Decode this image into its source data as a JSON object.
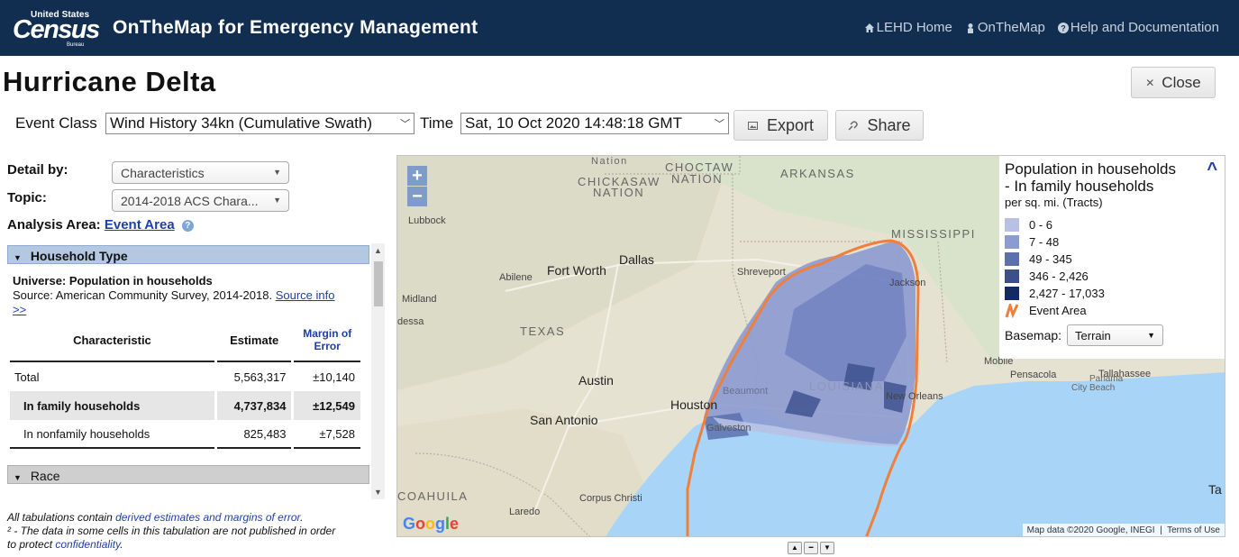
{
  "header": {
    "logo_line1": "United States",
    "logo_line2": "Census",
    "logo_line3": "Bureau",
    "app_title": "OnTheMap for Emergency Management",
    "nav": [
      {
        "label": "LEHD Home",
        "icon": "home-icon"
      },
      {
        "label": "OnTheMap",
        "icon": "person-icon"
      },
      {
        "label": "Help and Documentation",
        "icon": "help-circle-icon"
      }
    ]
  },
  "page": {
    "title": "Hurricane Delta",
    "close_label": "Close"
  },
  "controls": {
    "event_class_label": "Event Class",
    "event_class_value": "Wind History 34kn (Cumulative Swath)",
    "time_label": "Time",
    "time_value": "Sat, 10 Oct 2020 14:48:18 GMT",
    "export_label": "Export",
    "share_label": "Share"
  },
  "panel": {
    "detail_label": "Detail by:",
    "detail_value": "Characteristics",
    "topic_label": "Topic:",
    "topic_value": "2014-2018 ACS Chara...",
    "analysis_label": "Analysis Area:",
    "analysis_value": "Event Area",
    "section1": "Household Type",
    "universe": "Universe: Population in households",
    "source_text": "Source: American Community Survey, 2014-2018.",
    "source_link": "Source info",
    "more_link": ">>",
    "table": {
      "headers": [
        "Characteristic",
        "Estimate",
        "Margin of Error"
      ],
      "rows": [
        {
          "label": "Total",
          "estimate": "5,563,317",
          "moe": "±10,140"
        },
        {
          "label": "In family households",
          "estimate": "4,737,834",
          "moe": "±12,549"
        },
        {
          "label": "In nonfamily households",
          "estimate": "825,483",
          "moe": "±7,528"
        }
      ]
    },
    "section2": "Race",
    "footnote1_a": "All tabulations contain ",
    "footnote1_link": "derived estimates and margins of error",
    "footnote1_b": ".",
    "footnote2": "² - The data in some cells in this tabulation are not published in order",
    "footnote3_a": "to protect ",
    "footnote3_link": "confidentiality",
    "footnote3_b": "."
  },
  "map": {
    "labels": {
      "oklahoma_nation": "Nation",
      "choctaw": "CHOCTAW",
      "choctaw_nation": "NATION",
      "chickasaw": "CHICKASAW",
      "chickasaw_nation": "NATION",
      "arkansas": "ARKANSAS",
      "mississippi": "MISSISSIPPI",
      "texas": "TEXAS",
      "louisiana": "LOUISIANA",
      "coahuila": "COAHUILA",
      "lubbock": "Lubbock",
      "abilene": "Abilene",
      "fort_worth": "Fort Worth",
      "dallas": "Dallas",
      "midland": "Midland",
      "odessa": "dessa",
      "shreveport": "Shreveport",
      "jackson": "Jackson",
      "austin": "Austin",
      "houston": "Houston",
      "beaumont": "Beaumont",
      "san_antonio": "San Antonio",
      "galveston": "Galveston",
      "new_orleans": "New Orleans",
      "mobile": "Mobile",
      "pensacola": "Pensacola",
      "tallahassee": "Tallahassee",
      "panama_city": "Panama",
      "panama_city2": "City Beach",
      "corpus_christi": "Corpus Christi",
      "laredo": "Laredo",
      "tampa": "Ta"
    },
    "google": "Google",
    "attribution": "Map data ©2020 Google, INEGI",
    "terms": "Terms of Use",
    "zoom_in": "+",
    "zoom_out": "−"
  },
  "legend": {
    "title1": "Population in households",
    "title2": "- In family households",
    "subtitle": "per sq. mi. (Tracts)",
    "classes": [
      {
        "label": "0 - 6",
        "color": "#b8c1e3"
      },
      {
        "label": "7 - 48",
        "color": "#8c9bd0"
      },
      {
        "label": "49 - 345",
        "color": "#5d70ae"
      },
      {
        "label": "346 - 2,426",
        "color": "#3a4f8c"
      },
      {
        "label": "2,427 - 17,033",
        "color": "#142a63"
      }
    ],
    "event_area_label": "Event Area",
    "event_area_color": "#f07f3c",
    "basemap_label": "Basemap:",
    "basemap_value": "Terrain"
  }
}
